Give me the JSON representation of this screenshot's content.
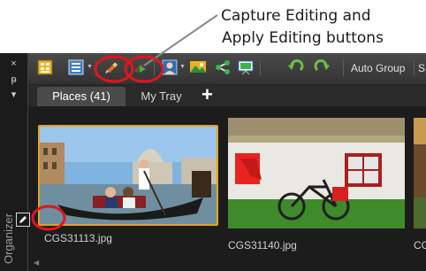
{
  "annotation": {
    "line1": "Capture Editing and",
    "line2": "Apply Editing buttons"
  },
  "sidebar": {
    "label": "Organizer",
    "close_glyph": "×",
    "pin_glyph": "ᵽ",
    "menu_glyph": "▾"
  },
  "toolbar": {
    "auto_group_label": "Auto Group",
    "overflow_label": "S",
    "icons": [
      "view-grid-icon",
      "list-view-icon",
      "capture-editing-icon",
      "apply-editing-icon",
      "person-icon",
      "landscape-icon",
      "share-icon",
      "slideshow-icon",
      "rotate-left-icon",
      "rotate-right-icon"
    ]
  },
  "tabs": {
    "active": "Places (41)",
    "inactive": "My Tray",
    "add_label": "+"
  },
  "thumbnails": [
    {
      "filename": "CGS31113.jpg",
      "selected": true,
      "has_edits": true
    },
    {
      "filename": "CGS31140.jpg",
      "selected": false,
      "has_edits": false
    },
    {
      "filename": "CG",
      "selected": false,
      "has_edits": false
    }
  ],
  "colors": {
    "selection_border": "#e3a21e",
    "highlight_circle": "#e0161b",
    "callout_line": "#8a8a8a"
  }
}
